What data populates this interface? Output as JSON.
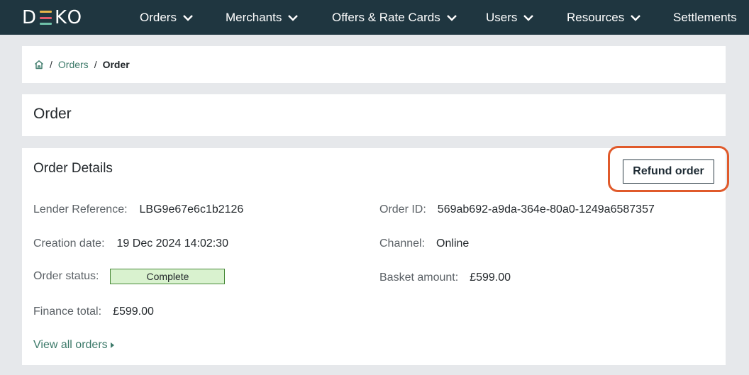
{
  "brand": {
    "logo_left": "D",
    "logo_right": "KO",
    "stripe_colors": [
      "#e8b64a",
      "#e05a6b",
      "#6fc1a9"
    ]
  },
  "nav": {
    "items": [
      {
        "label": "Orders",
        "icon": "chevron-down-icon"
      },
      {
        "label": "Merchants",
        "icon": "chevron-down-icon"
      },
      {
        "label": "Offers & Rate Cards",
        "icon": "chevron-down-icon"
      },
      {
        "label": "Users",
        "icon": "chevron-down-icon"
      },
      {
        "label": "Resources",
        "icon": "chevron-down-icon"
      },
      {
        "label": "Settlements"
      }
    ]
  },
  "breadcrumb": {
    "home_icon": "home-icon",
    "separator": "/",
    "items": [
      "Orders",
      "Order"
    ]
  },
  "page": {
    "title": "Order"
  },
  "order_details": {
    "title": "Order Details",
    "refund_label": "Refund order",
    "lender_reference_label": "Lender Reference:",
    "lender_reference": "LBG9e67e6c1b2126",
    "order_id_label": "Order ID:",
    "order_id": "569ab692-a9da-364e-80a0-1249a6587357",
    "creation_date_label": "Creation date:",
    "creation_date": "19 Dec 2024 14:02:30",
    "channel_label": "Channel:",
    "channel": "Online",
    "order_status_label": "Order status:",
    "order_status": "Complete",
    "basket_amount_label": "Basket amount:",
    "basket_amount": "£599.00",
    "finance_total_label": "Finance total:",
    "finance_total": "£599.00",
    "view_all_label": "View all orders"
  },
  "colors": {
    "nav_bg": "#1f3640",
    "accent_link": "#3d7a6a",
    "highlight": "#e05a2b",
    "status_complete_bg": "#d9f2cf",
    "status_complete_border": "#4a8a3a"
  }
}
